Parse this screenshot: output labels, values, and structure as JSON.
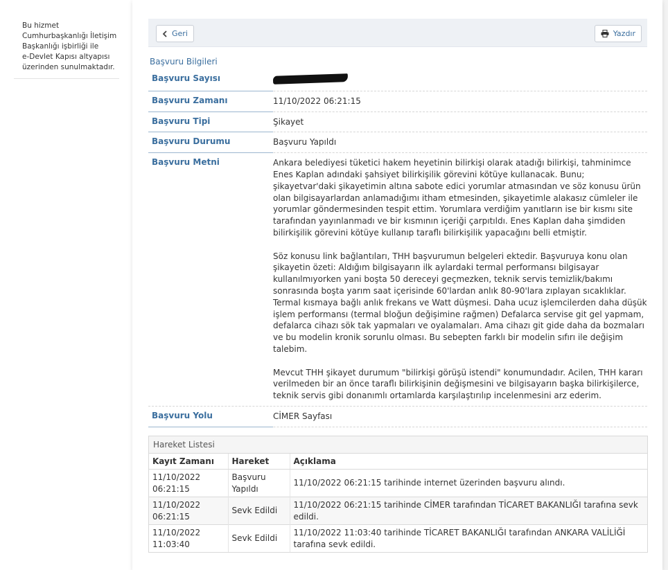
{
  "sidebar": {
    "note_lines": [
      "Bu hizmet",
      "Cumhurbaşkanlığı İletişim",
      "Başkanlığı işbirliği ile",
      "e-Devlet Kapısı altyapısı",
      "üzerinden sunulmaktadır."
    ]
  },
  "toolbar": {
    "back_label": "Geri",
    "print_label": "Yazdır"
  },
  "section_title": "Başvuru Bilgileri",
  "details": {
    "sayi_label": "Başvuru Sayısı",
    "zaman_label": "Başvuru Zamanı",
    "zaman_value": "11/10/2022 06:21:15",
    "tipi_label": "Başvuru Tipi",
    "tipi_value": "Şikayet",
    "durum_label": "Başvuru Durumu",
    "durum_value": "Başvuru Yapıldı",
    "metin_label": "Başvuru Metni",
    "metin_paragraphs": [
      "Ankara belediyesi tüketici hakem heyetinin bilirkişi olarak atadığı bilirkişi, tahminimce Enes Kaplan adındaki şahsiyet bilirkişilik görevini kötüye kullanacak. Bunu; şikayetvar'daki şikayetimin altına sabote edici yorumlar atmasından ve söz konusu ürün olan bilgisayarlardan anlamadığımı itham etmesinden, şikayetimle alakasız cümleler ile yorumlar göndermesinden tespit ettim. Yorumlara verdiğim yanıtların ise bir kısmı site tarafından yayınlanmadı ve bir kısmının içeriği çarpıtıldı. Enes Kaplan daha şimdiden bilirkişilik görevini kötüye kullanıp taraflı bilirkişilik yapacağını belli etmiştir.",
      "Söz konusu link bağlantıları, THH başvurumun belgeleri ektedir. Başvuruya konu olan şikayetin özeti: Aldığım bilgisayarın ilk aylardaki termal performansı bilgisayar kullanılmıyorken yani boşta 50 dereceyi geçmezken, teknik servis temizlik/bakımı sonrasında boşta yarım saat içerisinde 60'lardan anlık 80-90'lara zıplayan sıcaklıklar. Termal kısmaya bağlı anlık frekans ve Watt düşmesi. Daha ucuz işlemcilerden daha düşük işlem performansı (termal bloğun değişimine rağmen) Defalarca servise git gel yapmam, defalarca cihazı sök tak yapmaları ve oyalamaları. Ama cihazı git gide daha da bozmaları ve bu modelin kronik sorunlu olması. Bu sebepten farklı bir modelin sıfırı ile değişim talebim.",
      "Mevcut THH şikayet durumum \"bilirkişi görüşü istendi\" konumundadır. Acilen, THH kararı verilmeden bir an önce taraflı bilirkişinin değişmesini ve bilgisayarın başka bilirkişilerce, teknik servis gibi donanımlı ortamlarda karşılaştırılıp incelenmesini arz ederim."
    ],
    "yolu_label": "Başvuru Yolu",
    "yolu_value": "CİMER Sayfası"
  },
  "history": {
    "title": "Hareket Listesi",
    "columns": [
      "Kayıt Zamanı",
      "Hareket",
      "Açıklama"
    ],
    "rows": [
      [
        "11/10/2022 06:21:15",
        "Başvuru Yapıldı",
        "11/10/2022 06:21:15 tarihinde internet üzerinden başvuru alındı."
      ],
      [
        "11/10/2022 06:21:15",
        "Sevk Edildi",
        "11/10/2022 06:21:15 tarihinde CİMER tarafından TİCARET BAKANLIĞI tarafına sevk edildi."
      ],
      [
        "11/10/2022 11:03:40",
        "Sevk Edildi",
        "11/10/2022 11:03:40 tarihinde TİCARET BAKANLIĞI tarafından ANKARA VALİLİĞİ tarafına sevk edildi."
      ]
    ]
  },
  "icons": {
    "back": "chevron-left-icon",
    "print": "printer-icon"
  },
  "colors": {
    "accent": "#3a6e9e",
    "toolbar_bg": "#eef1f5"
  }
}
